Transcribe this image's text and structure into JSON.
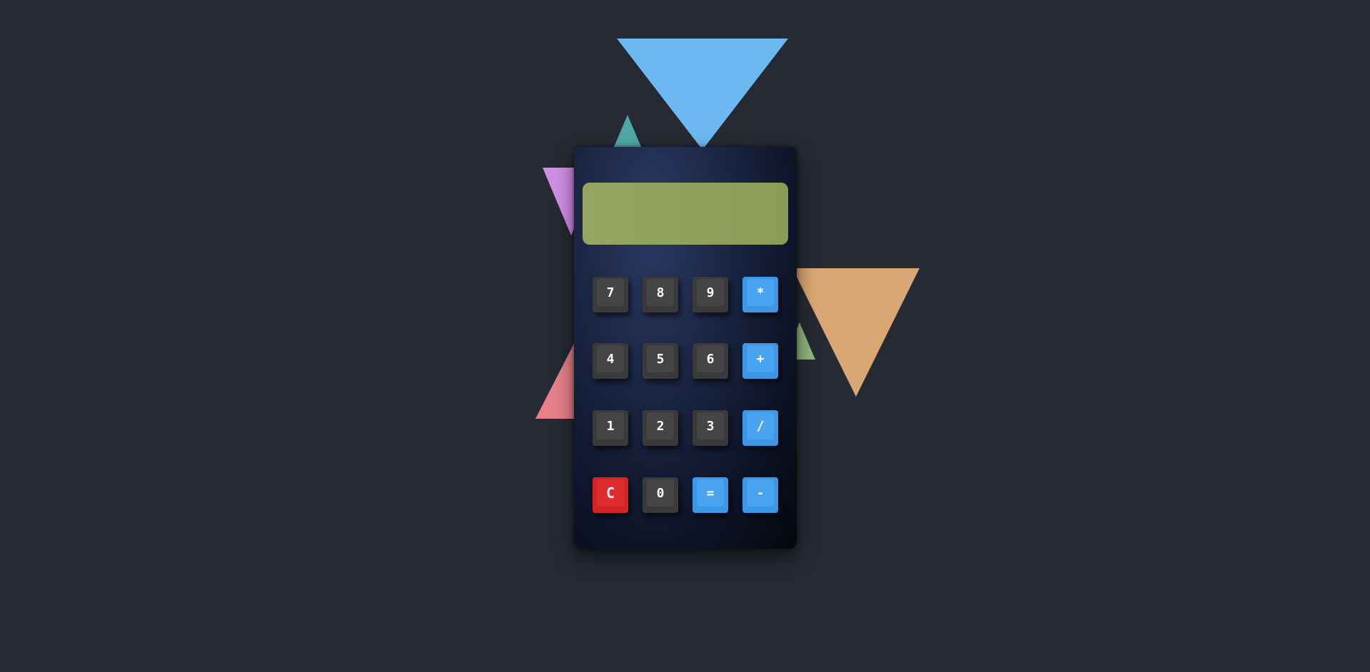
{
  "display": {
    "value": ""
  },
  "keys": {
    "k7": "7",
    "k8": "8",
    "k9": "9",
    "mul": "*",
    "k4": "4",
    "k5": "5",
    "k6": "6",
    "add": "+",
    "k1": "1",
    "k2": "2",
    "k3": "3",
    "div": "/",
    "clear": "C",
    "k0": "0",
    "eq": "=",
    "sub": "-"
  },
  "colors": {
    "background": "#262a32",
    "display": "#8fa25c",
    "digit_key": "#3a3a3a",
    "operator_key": "#3b98e8",
    "clear_key": "#d42424",
    "triangles": [
      "#6cb8f0",
      "#4fa8a8",
      "#d18ee6",
      "#e8808a",
      "#8fb87a",
      "#d9a774"
    ]
  }
}
